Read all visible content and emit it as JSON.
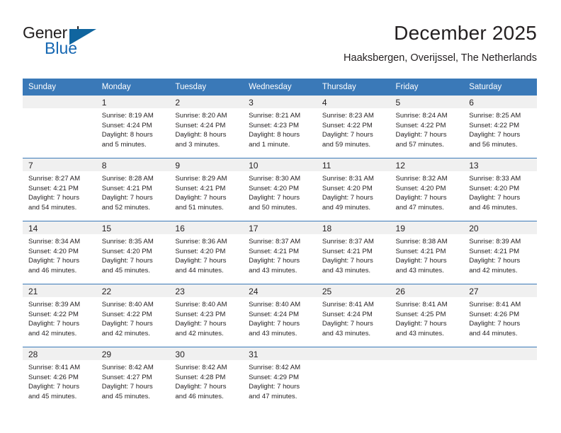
{
  "brand": {
    "name_part1": "General",
    "name_part2": "Blue",
    "logo_icon": "triangle-flag-icon",
    "accent_color": "#10659f"
  },
  "header": {
    "title": "December 2025",
    "subtitle": "Haaksbergen, Overijssel, The Netherlands"
  },
  "theme": {
    "header_bg": "#3a79b8",
    "daynum_bg": "#f0f0f0",
    "text_color": "#231f20"
  },
  "calendar": {
    "weekday_headers": [
      "Sunday",
      "Monday",
      "Tuesday",
      "Wednesday",
      "Thursday",
      "Friday",
      "Saturday"
    ],
    "weeks": [
      [
        {
          "day": "",
          "empty": true,
          "sunrise": "",
          "sunset": "",
          "daylight_l1": "",
          "daylight_l2": ""
        },
        {
          "day": "1",
          "sunrise": "Sunrise: 8:19 AM",
          "sunset": "Sunset: 4:24 PM",
          "daylight_l1": "Daylight: 8 hours",
          "daylight_l2": "and 5 minutes."
        },
        {
          "day": "2",
          "sunrise": "Sunrise: 8:20 AM",
          "sunset": "Sunset: 4:24 PM",
          "daylight_l1": "Daylight: 8 hours",
          "daylight_l2": "and 3 minutes."
        },
        {
          "day": "3",
          "sunrise": "Sunrise: 8:21 AM",
          "sunset": "Sunset: 4:23 PM",
          "daylight_l1": "Daylight: 8 hours",
          "daylight_l2": "and 1 minute."
        },
        {
          "day": "4",
          "sunrise": "Sunrise: 8:23 AM",
          "sunset": "Sunset: 4:22 PM",
          "daylight_l1": "Daylight: 7 hours",
          "daylight_l2": "and 59 minutes."
        },
        {
          "day": "5",
          "sunrise": "Sunrise: 8:24 AM",
          "sunset": "Sunset: 4:22 PM",
          "daylight_l1": "Daylight: 7 hours",
          "daylight_l2": "and 57 minutes."
        },
        {
          "day": "6",
          "sunrise": "Sunrise: 8:25 AM",
          "sunset": "Sunset: 4:22 PM",
          "daylight_l1": "Daylight: 7 hours",
          "daylight_l2": "and 56 minutes."
        }
      ],
      [
        {
          "day": "7",
          "sunrise": "Sunrise: 8:27 AM",
          "sunset": "Sunset: 4:21 PM",
          "daylight_l1": "Daylight: 7 hours",
          "daylight_l2": "and 54 minutes."
        },
        {
          "day": "8",
          "sunrise": "Sunrise: 8:28 AM",
          "sunset": "Sunset: 4:21 PM",
          "daylight_l1": "Daylight: 7 hours",
          "daylight_l2": "and 52 minutes."
        },
        {
          "day": "9",
          "sunrise": "Sunrise: 8:29 AM",
          "sunset": "Sunset: 4:21 PM",
          "daylight_l1": "Daylight: 7 hours",
          "daylight_l2": "and 51 minutes."
        },
        {
          "day": "10",
          "sunrise": "Sunrise: 8:30 AM",
          "sunset": "Sunset: 4:20 PM",
          "daylight_l1": "Daylight: 7 hours",
          "daylight_l2": "and 50 minutes."
        },
        {
          "day": "11",
          "sunrise": "Sunrise: 8:31 AM",
          "sunset": "Sunset: 4:20 PM",
          "daylight_l1": "Daylight: 7 hours",
          "daylight_l2": "and 49 minutes."
        },
        {
          "day": "12",
          "sunrise": "Sunrise: 8:32 AM",
          "sunset": "Sunset: 4:20 PM",
          "daylight_l1": "Daylight: 7 hours",
          "daylight_l2": "and 47 minutes."
        },
        {
          "day": "13",
          "sunrise": "Sunrise: 8:33 AM",
          "sunset": "Sunset: 4:20 PM",
          "daylight_l1": "Daylight: 7 hours",
          "daylight_l2": "and 46 minutes."
        }
      ],
      [
        {
          "day": "14",
          "sunrise": "Sunrise: 8:34 AM",
          "sunset": "Sunset: 4:20 PM",
          "daylight_l1": "Daylight: 7 hours",
          "daylight_l2": "and 46 minutes."
        },
        {
          "day": "15",
          "sunrise": "Sunrise: 8:35 AM",
          "sunset": "Sunset: 4:20 PM",
          "daylight_l1": "Daylight: 7 hours",
          "daylight_l2": "and 45 minutes."
        },
        {
          "day": "16",
          "sunrise": "Sunrise: 8:36 AM",
          "sunset": "Sunset: 4:20 PM",
          "daylight_l1": "Daylight: 7 hours",
          "daylight_l2": "and 44 minutes."
        },
        {
          "day": "17",
          "sunrise": "Sunrise: 8:37 AM",
          "sunset": "Sunset: 4:21 PM",
          "daylight_l1": "Daylight: 7 hours",
          "daylight_l2": "and 43 minutes."
        },
        {
          "day": "18",
          "sunrise": "Sunrise: 8:37 AM",
          "sunset": "Sunset: 4:21 PM",
          "daylight_l1": "Daylight: 7 hours",
          "daylight_l2": "and 43 minutes."
        },
        {
          "day": "19",
          "sunrise": "Sunrise: 8:38 AM",
          "sunset": "Sunset: 4:21 PM",
          "daylight_l1": "Daylight: 7 hours",
          "daylight_l2": "and 43 minutes."
        },
        {
          "day": "20",
          "sunrise": "Sunrise: 8:39 AM",
          "sunset": "Sunset: 4:21 PM",
          "daylight_l1": "Daylight: 7 hours",
          "daylight_l2": "and 42 minutes."
        }
      ],
      [
        {
          "day": "21",
          "sunrise": "Sunrise: 8:39 AM",
          "sunset": "Sunset: 4:22 PM",
          "daylight_l1": "Daylight: 7 hours",
          "daylight_l2": "and 42 minutes."
        },
        {
          "day": "22",
          "sunrise": "Sunrise: 8:40 AM",
          "sunset": "Sunset: 4:22 PM",
          "daylight_l1": "Daylight: 7 hours",
          "daylight_l2": "and 42 minutes."
        },
        {
          "day": "23",
          "sunrise": "Sunrise: 8:40 AM",
          "sunset": "Sunset: 4:23 PM",
          "daylight_l1": "Daylight: 7 hours",
          "daylight_l2": "and 42 minutes."
        },
        {
          "day": "24",
          "sunrise": "Sunrise: 8:40 AM",
          "sunset": "Sunset: 4:24 PM",
          "daylight_l1": "Daylight: 7 hours",
          "daylight_l2": "and 43 minutes."
        },
        {
          "day": "25",
          "sunrise": "Sunrise: 8:41 AM",
          "sunset": "Sunset: 4:24 PM",
          "daylight_l1": "Daylight: 7 hours",
          "daylight_l2": "and 43 minutes."
        },
        {
          "day": "26",
          "sunrise": "Sunrise: 8:41 AM",
          "sunset": "Sunset: 4:25 PM",
          "daylight_l1": "Daylight: 7 hours",
          "daylight_l2": "and 43 minutes."
        },
        {
          "day": "27",
          "sunrise": "Sunrise: 8:41 AM",
          "sunset": "Sunset: 4:26 PM",
          "daylight_l1": "Daylight: 7 hours",
          "daylight_l2": "and 44 minutes."
        }
      ],
      [
        {
          "day": "28",
          "sunrise": "Sunrise: 8:41 AM",
          "sunset": "Sunset: 4:26 PM",
          "daylight_l1": "Daylight: 7 hours",
          "daylight_l2": "and 45 minutes."
        },
        {
          "day": "29",
          "sunrise": "Sunrise: 8:42 AM",
          "sunset": "Sunset: 4:27 PM",
          "daylight_l1": "Daylight: 7 hours",
          "daylight_l2": "and 45 minutes."
        },
        {
          "day": "30",
          "sunrise": "Sunrise: 8:42 AM",
          "sunset": "Sunset: 4:28 PM",
          "daylight_l1": "Daylight: 7 hours",
          "daylight_l2": "and 46 minutes."
        },
        {
          "day": "31",
          "sunrise": "Sunrise: 8:42 AM",
          "sunset": "Sunset: 4:29 PM",
          "daylight_l1": "Daylight: 7 hours",
          "daylight_l2": "and 47 minutes."
        },
        {
          "day": "",
          "empty": true,
          "sunrise": "",
          "sunset": "",
          "daylight_l1": "",
          "daylight_l2": ""
        },
        {
          "day": "",
          "empty": true,
          "sunrise": "",
          "sunset": "",
          "daylight_l1": "",
          "daylight_l2": ""
        },
        {
          "day": "",
          "empty": true,
          "sunrise": "",
          "sunset": "",
          "daylight_l1": "",
          "daylight_l2": ""
        }
      ]
    ]
  }
}
